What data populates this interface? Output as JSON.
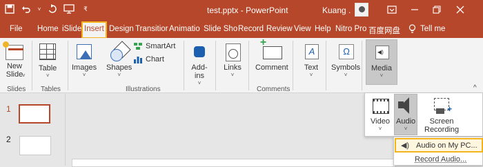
{
  "titlebar": {
    "filename": "test.pptx",
    "separator": "-",
    "app": "PowerPoint",
    "user": "Kuang .",
    "qat_icons": [
      "save-icon",
      "undo-icon",
      "undo-dropdown-icon",
      "redo-icon",
      "presentation-icon",
      "customize-qat-icon"
    ],
    "window_icons": [
      "ribbon-display-options-icon",
      "minimize-icon",
      "restore-icon",
      "close-icon"
    ]
  },
  "tabs": [
    {
      "label": "File"
    },
    {
      "label": "Home"
    },
    {
      "label": "iSlide"
    },
    {
      "label": "Insert"
    },
    {
      "label": "Design"
    },
    {
      "label": "Transitior"
    },
    {
      "label": "Animatio"
    },
    {
      "label": "Slide Sho"
    },
    {
      "label": "Record"
    },
    {
      "label": "Review"
    },
    {
      "label": "View"
    },
    {
      "label": "Help"
    },
    {
      "label": "Nitro Pro"
    },
    {
      "label": "百度网盘"
    }
  ],
  "tellme": {
    "label": "Tell me"
  },
  "ribbon": {
    "new_slide": {
      "line1": "New",
      "line2": "Slide",
      "caret": "˅"
    },
    "table": {
      "label": "Table",
      "caret": "˅"
    },
    "images": {
      "label": "Images",
      "caret": "˅"
    },
    "shapes": {
      "label": "Shapes",
      "caret": "˅"
    },
    "smartart": {
      "label": "SmartArt"
    },
    "chart": {
      "label": "Chart"
    },
    "addins": {
      "line1": "Add-",
      "line2": "ins",
      "caret": "˅"
    },
    "links": {
      "label": "Links",
      "caret": "˅"
    },
    "comment": {
      "label": "Comment"
    },
    "text": {
      "label": "Text",
      "caret": "˅"
    },
    "symbols": {
      "label": "Symbols",
      "caret": "˅"
    },
    "media": {
      "label": "Media",
      "caret": "˅"
    },
    "groups": {
      "slides": "Slides",
      "tables": "Tables",
      "illustrations": "Illustrations",
      "comments": "Comments"
    }
  },
  "slides_panel": {
    "slides": [
      {
        "number": "1"
      },
      {
        "number": "2"
      }
    ]
  },
  "media_menu": {
    "video": {
      "label": "Video",
      "caret": "˅"
    },
    "audio": {
      "label": "Audio",
      "caret": "˅"
    },
    "screen_recording": {
      "line1": "Screen",
      "line2": "Recording"
    }
  },
  "audio_submenu": {
    "items": [
      {
        "label": "Audio on My PC..."
      },
      {
        "label": "Record Audio..."
      }
    ]
  }
}
